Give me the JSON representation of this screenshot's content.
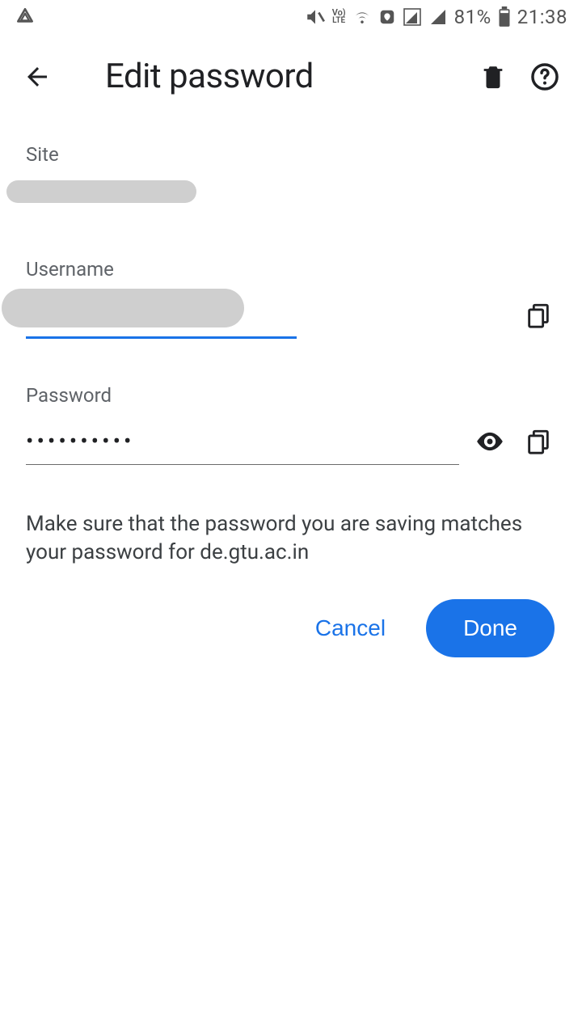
{
  "statusbar": {
    "battery_pct": "81%",
    "time": "21:38"
  },
  "header": {
    "title": "Edit password"
  },
  "fields": {
    "site_label": "Site",
    "site_value_redacted": "de.gtu.ac.in",
    "username_label": "Username",
    "username_value": "",
    "password_label": "Password",
    "password_masked": "••••••••••"
  },
  "hint": "Make sure that the password you are saving matches your password for de.gtu.ac.in",
  "buttons": {
    "cancel": "Cancel",
    "done": "Done"
  }
}
